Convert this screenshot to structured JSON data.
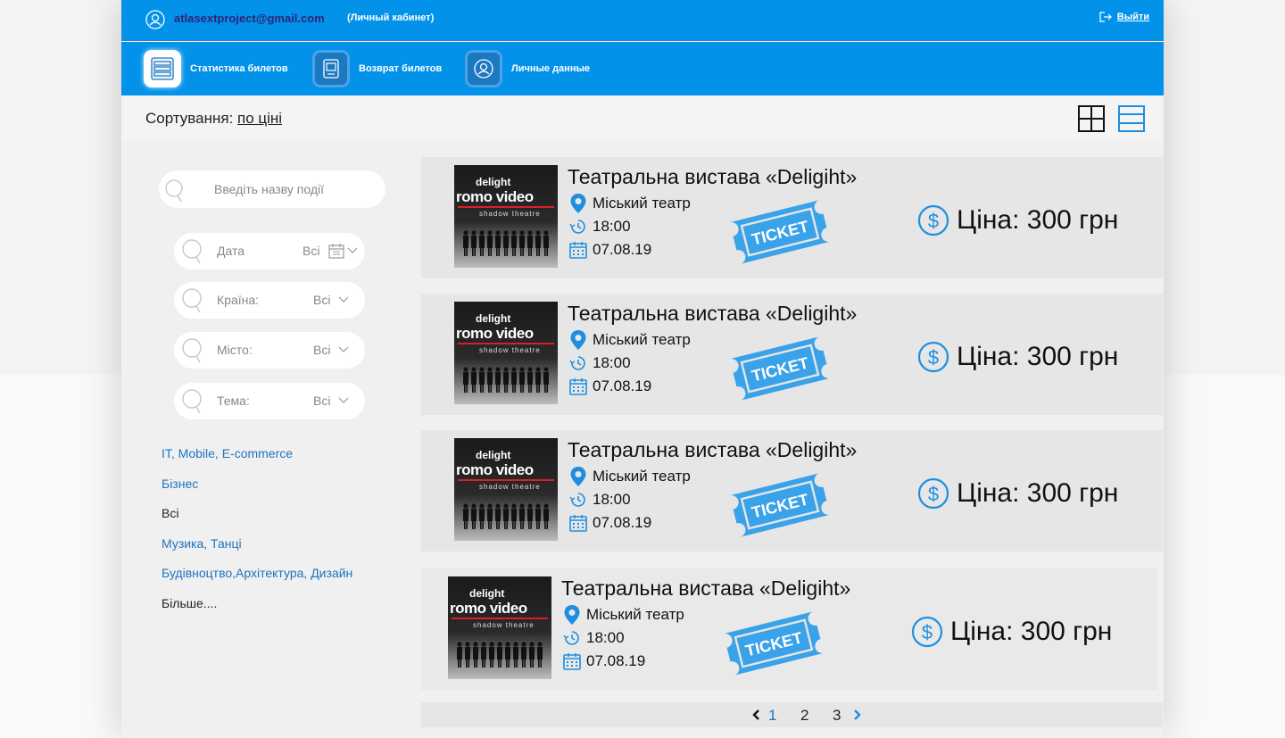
{
  "header": {
    "email": "atlasextproject@gmail.com",
    "cabinet_label": "(Личный кабинет)",
    "logout_label": "Выйти"
  },
  "nav": {
    "items": [
      {
        "label": "Статистика билетов",
        "icon": "ticket-stats-icon",
        "active": true
      },
      {
        "label": "Возврат билетов",
        "icon": "ticket-return-icon",
        "active": false
      },
      {
        "label": "Личные данные",
        "icon": "user-icon",
        "active": false
      }
    ]
  },
  "sort": {
    "label": "Сортування: ",
    "value": "по ціні"
  },
  "search": {
    "placeholder": "Введіть назву події"
  },
  "filters": [
    {
      "label": "Дата",
      "value": "Всі"
    },
    {
      "label": "Країна:",
      "value": "Всі"
    },
    {
      "label": "Місто:",
      "value": "Всі"
    },
    {
      "label": "Тема:",
      "value": "Всі"
    }
  ],
  "categories": [
    {
      "label": "IT, Mobile, E-commerce",
      "link": true
    },
    {
      "label": "Бізнес",
      "link": true
    },
    {
      "label": "Всі",
      "link": false
    },
    {
      "label": "Музика, Танці",
      "link": true
    },
    {
      "label": "Будівноцтво,Архітектура, Дизайн",
      "link": true
    },
    {
      "label": "Більше....",
      "link": false
    }
  ],
  "events": [
    {
      "title": "Театральна вистава «Deligiht»",
      "venue": "Міський театр",
      "time": "18:00",
      "date": "07.08.19",
      "price": "Ціна: 300 грн",
      "ticket": "TICKET",
      "poster_top": "delight",
      "poster_main": "romo video",
      "poster_sub": "shadow theatre"
    },
    {
      "title": "Театральна вистава «Deligiht»",
      "venue": "Міський театр",
      "time": "18:00",
      "date": "07.08.19",
      "price": "Ціна: 300 грн",
      "ticket": "TICKET",
      "poster_top": "delight",
      "poster_main": "romo video",
      "poster_sub": "shadow theatre"
    },
    {
      "title": "Театральна вистава «Deligiht»",
      "venue": "Міський театр",
      "time": "18:00",
      "date": "07.08.19",
      "price": "Ціна: 300 грн",
      "ticket": "TICKET",
      "poster_top": "delight",
      "poster_main": "romo video",
      "poster_sub": "shadow theatre"
    },
    {
      "title": "Театральна вистава «Deligiht»",
      "venue": "Міський театр",
      "time": "18:00",
      "date": "07.08.19",
      "price": "Ціна: 300 грн",
      "ticket": "TICKET",
      "poster_top": "delight",
      "poster_main": "romo video",
      "poster_sub": "shadow theatre"
    }
  ],
  "pagination": {
    "pages": [
      "1",
      "2",
      "3"
    ],
    "current": "1"
  },
  "colors": {
    "primary": "#0392ea",
    "link": "#1e73be",
    "email": "#2b2578",
    "ticket": "#3aa2e8"
  }
}
